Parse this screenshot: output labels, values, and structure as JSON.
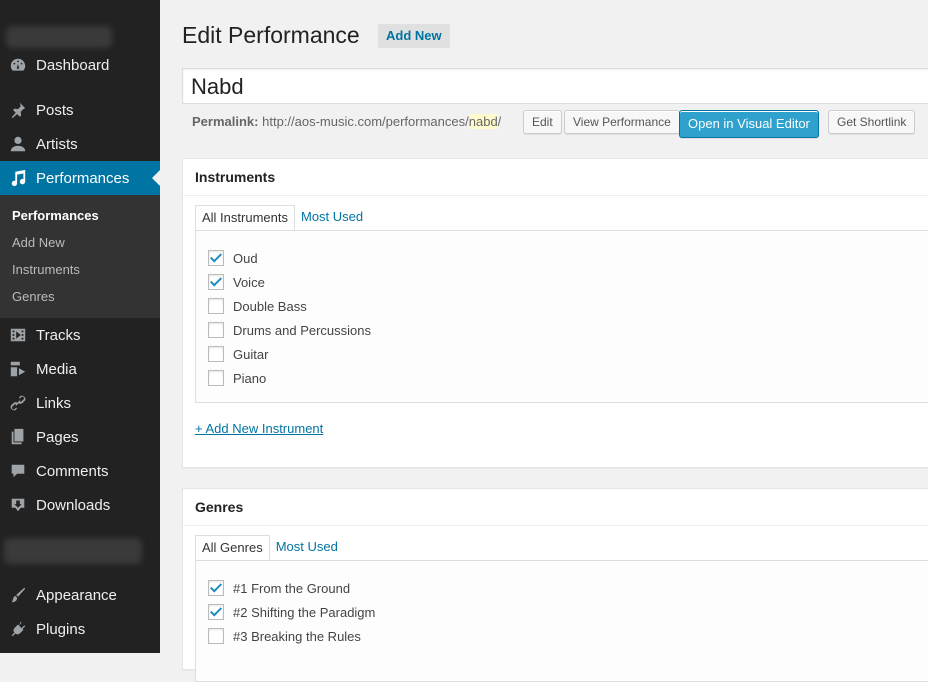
{
  "sidebar": {
    "items": [
      {
        "label": "Dashboard",
        "icon": "dashboard-icon"
      },
      {
        "label": "Posts",
        "icon": "pin-icon"
      },
      {
        "label": "Artists",
        "icon": "user-icon"
      },
      {
        "label": "Performances",
        "icon": "music-note-icon",
        "active": true
      },
      {
        "label": "Tracks",
        "icon": "video-icon"
      },
      {
        "label": "Media",
        "icon": "media-icon"
      },
      {
        "label": "Links",
        "icon": "link-icon"
      },
      {
        "label": "Pages",
        "icon": "pages-icon"
      },
      {
        "label": "Comments",
        "icon": "comment-icon"
      },
      {
        "label": "Downloads",
        "icon": "download-icon"
      },
      {
        "label": "Appearance",
        "icon": "paintbrush-icon"
      },
      {
        "label": "Plugins",
        "icon": "plugin-icon"
      }
    ],
    "submenu": [
      "Performances",
      "Add New",
      "Instruments",
      "Genres"
    ]
  },
  "header": {
    "title": "Edit Performance",
    "add_new": "Add New"
  },
  "post": {
    "title": "Nabd",
    "permalink_label": "Permalink:",
    "permalink_base": "http://aos-music.com/performances/",
    "permalink_slug": "nabd",
    "permalink_trail": "/",
    "buttons": {
      "edit": "Edit",
      "view": "View Performance",
      "visual_editor": "Open in Visual Editor",
      "shortlink": "Get Shortlink"
    }
  },
  "instruments": {
    "title": "Instruments",
    "tabs": [
      "All Instruments",
      "Most Used"
    ],
    "items": [
      {
        "label": "Oud",
        "checked": true
      },
      {
        "label": "Voice",
        "checked": true
      },
      {
        "label": "Double Bass",
        "checked": false
      },
      {
        "label": "Drums and Percussions",
        "checked": false
      },
      {
        "label": "Guitar",
        "checked": false
      },
      {
        "label": "Piano",
        "checked": false
      }
    ],
    "add_link": "+ Add New Instrument"
  },
  "genres": {
    "title": "Genres",
    "tabs": [
      "All Genres",
      "Most Used"
    ],
    "items": [
      {
        "label": "#1 From the Ground",
        "checked": true
      },
      {
        "label": "#2 Shifting the Paradigm",
        "checked": true
      },
      {
        "label": "#3 Breaking the Rules",
        "checked": false
      }
    ]
  },
  "colors": {
    "sidebar_bg": "#222222",
    "active_bg": "#0074a2",
    "primary_button": "#2ea2cc",
    "link": "#0074a2"
  }
}
